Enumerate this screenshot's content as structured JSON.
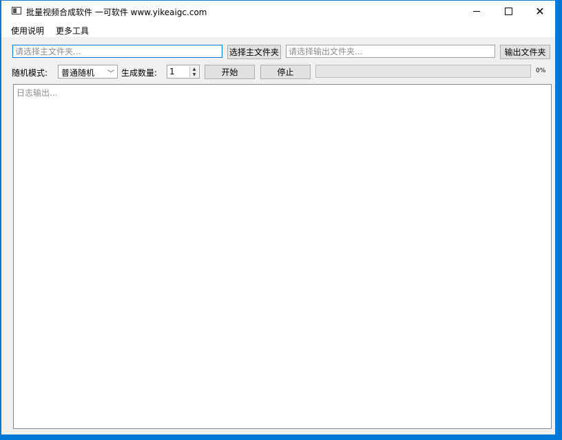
{
  "window": {
    "title": "批量视频合成软件 一可软件 www.yikeaigc.com",
    "icon": "app-window-icon"
  },
  "menu": {
    "items": [
      "使用说明",
      "更多工具"
    ]
  },
  "main_folder": {
    "value": "",
    "placeholder": "请选择主文件夹...",
    "button_label": "选择主文件夹"
  },
  "output_folder": {
    "value": "",
    "placeholder": "请选择输出文件夹...",
    "button_label": "输出文件夹"
  },
  "controls": {
    "mode_label": "随机模式:",
    "mode_value": "普通随机",
    "count_label": "生成数量:",
    "count_value": "1",
    "start_label": "开始",
    "stop_label": "停止",
    "progress_fraction": 0,
    "progress_text": "0%"
  },
  "log": {
    "value": "",
    "placeholder": "日志输出..."
  },
  "colors": {
    "accent": "#0078d7",
    "progress_fill": "#06b025"
  }
}
